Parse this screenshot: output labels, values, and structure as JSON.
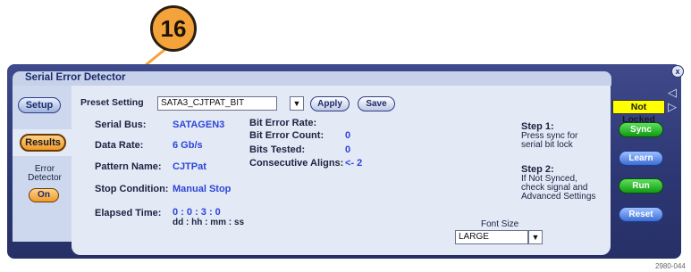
{
  "callout": {
    "number": "16"
  },
  "window": {
    "title": "Serial Error Detector",
    "close_glyph": "x"
  },
  "sidebar": {
    "setup_label": "Setup",
    "results_label": "Results",
    "error_detector_label": "Error Detector",
    "on_label": "On"
  },
  "preset": {
    "label": "Preset Setting",
    "value": "SATA3_CJTPAT_BIT",
    "apply_label": "Apply",
    "save_label": "Save"
  },
  "fields": {
    "serial_bus_label": "Serial Bus:",
    "serial_bus_value": "SATAGEN3",
    "data_rate_label": "Data Rate:",
    "data_rate_value": "6 Gb/s",
    "pattern_name_label": "Pattern Name:",
    "pattern_name_value": "CJTPat",
    "stop_condition_label": "Stop Condition:",
    "stop_condition_value": "Manual Stop",
    "elapsed_time_label": "Elapsed Time:",
    "elapsed_time_value": "0 : 0 : 3 : 0",
    "elapsed_time_format": "dd : hh : mm : ss"
  },
  "stats": {
    "bit_error_rate_label": "Bit Error Rate:",
    "bit_error_count_label": "Bit Error Count:",
    "bit_error_count_value": "0",
    "bits_tested_label": "Bits Tested:",
    "bits_tested_value": "0",
    "consecutive_aligns_label": "Consecutive Aligns:",
    "consecutive_aligns_value": "<- 2"
  },
  "steps": {
    "step1_title": "Step 1:",
    "step1_line1": "Press sync for",
    "step1_line2": "serial bit lock",
    "step2_title": "Step 2:",
    "step2_line1": "If Not Synced,",
    "step2_line2": "check signal and",
    "step2_line3": "Advanced Settings"
  },
  "font_size": {
    "label": "Font Size",
    "value": "LARGE"
  },
  "right_panel": {
    "status": "Not Locked",
    "sync_label": "Sync",
    "learn_label": "Learn",
    "run_label": "Run",
    "reset_label": "Reset"
  },
  "figure_code": "2980-044",
  "colors": {
    "panel": "#2c3672",
    "accent": "#f09a28",
    "status_bg": "#ffff00",
    "value_blue": "#2b46d8"
  }
}
